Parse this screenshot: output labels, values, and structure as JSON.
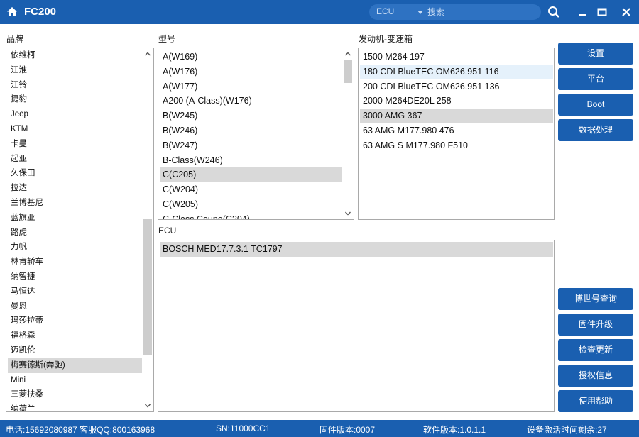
{
  "app": {
    "title": "FC200"
  },
  "search": {
    "category": "ECU",
    "placeholder": "搜索"
  },
  "labels": {
    "brand": "品牌",
    "model": "型号",
    "engine": "发动机-变速箱",
    "ecu": "ECU"
  },
  "brands": [
    "依维柯",
    "江淮",
    "江铃",
    "捷豹",
    "Jeep",
    "KTM",
    "卡曼",
    "起亚",
    "久保田",
    "拉达",
    "兰博基尼",
    "蓝旗亚",
    "路虎",
    "力帆",
    "林肯轿车",
    "纳智捷",
    "马恒达",
    "曼恩",
    "玛莎拉蒂",
    "福格森",
    "迈凯伦",
    "梅赛德斯(奔驰)",
    "Mini",
    "三菱扶桑",
    "纳荷兰"
  ],
  "brand_selected_index": 21,
  "models": [
    "A(W169)",
    "A(W176)",
    "A(W177)",
    "A200 (A-Class)(W176)",
    "B(W245)",
    "B(W246)",
    "B(W247)",
    "B-Class(W246)",
    "C(C205)",
    "C(W204)",
    "C(W205)",
    "C-Class Coupe(C204)"
  ],
  "model_selected_index": 8,
  "engines": [
    "1500 M264 197",
    "180 CDI BlueTEC OM626.951 116",
    "200 CDI BlueTEC OM626.951 136",
    "2000 M264DE20L 258",
    "3000 AMG 367",
    "63 AMG M177.980 476",
    "63 AMG S M177.980 F510"
  ],
  "engine_selected_index": 4,
  "engine_hover_index": 1,
  "ecus": [
    "BOSCH MED17.7.3.1 TC1797"
  ],
  "ecu_selected_index": 0,
  "side_buttons_top": [
    "设置",
    "平台",
    "Boot",
    "数据处理"
  ],
  "side_buttons_bottom": [
    "博世号查询",
    "固件升级",
    "检查更新",
    "授权信息",
    "使用帮助"
  ],
  "status": {
    "contact": "电话:15692080987 客服QQ:800163968",
    "sn": "SN:11000CC1",
    "firmware": "固件版本:0007",
    "software": "软件版本:1.0.1.1",
    "activation": "设备激活时间剩余:27"
  },
  "colors": {
    "titlebar": "#1a5fb0",
    "button": "#1a5fb0",
    "selected_row": "#d9d9d9",
    "hover_row": "#e5f1fb"
  }
}
